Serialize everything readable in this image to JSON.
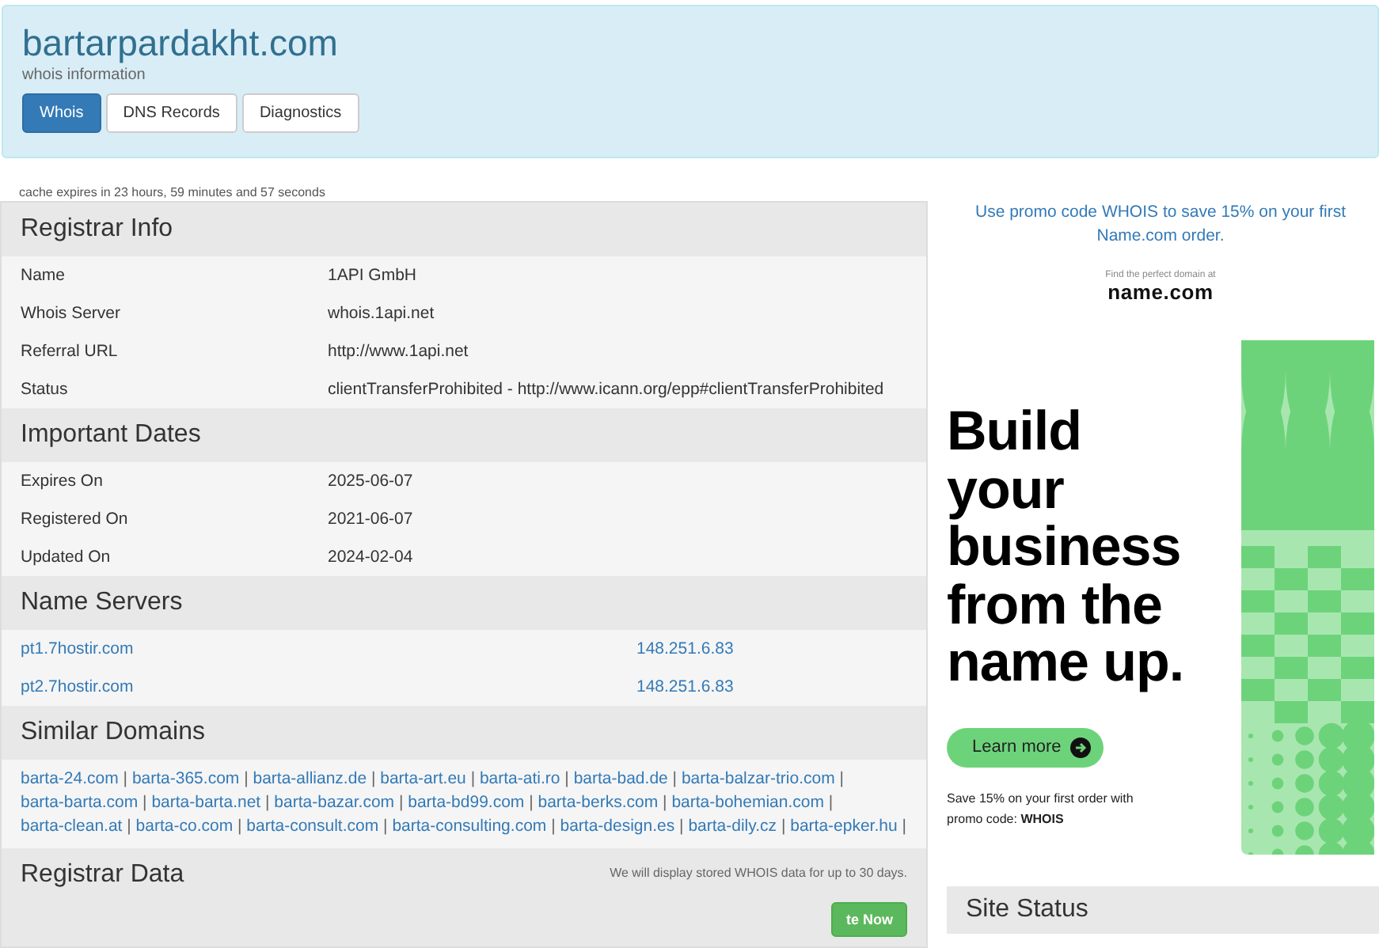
{
  "header": {
    "title": "bartarpardakht.com",
    "subtitle": "whois information",
    "tabs": [
      {
        "label": "Whois",
        "selected": true
      },
      {
        "label": "DNS Records",
        "selected": false
      },
      {
        "label": "Diagnostics",
        "selected": false
      }
    ]
  },
  "cache_note": "cache expires in 23 hours, 59 minutes and 57 seconds",
  "sections": [
    {
      "kind": "table",
      "title": "Registrar Info",
      "rows": [
        {
          "label": "Name",
          "value": "1API GmbH"
        },
        {
          "label": "Whois Server",
          "value": "whois.1api.net"
        },
        {
          "label": "Referral URL",
          "value": "http://www.1api.net"
        },
        {
          "label": "Status",
          "value": "clientTransferProhibited - http://www.icann.org/epp#clientTransferProhibited"
        }
      ]
    },
    {
      "kind": "table",
      "title": "Important Dates",
      "rows": [
        {
          "label": "Expires On",
          "value": "2025-06-07"
        },
        {
          "label": "Registered On",
          "value": "2021-06-07"
        },
        {
          "label": "Updated On",
          "value": "2024-02-04"
        }
      ]
    },
    {
      "kind": "servers",
      "title": "Name Servers",
      "rows": [
        {
          "label": "pt1.7hostir.com",
          "value": "148.251.6.83"
        },
        {
          "label": "pt2.7hostir.com",
          "value": "148.251.6.83"
        }
      ]
    },
    {
      "kind": "links",
      "title": "Similar Domains",
      "separator": "|",
      "links": [
        "barta-24.com",
        "barta-365.com",
        "barta-allianz.de",
        "barta-art.eu",
        "barta-ati.ro",
        "barta-bad.de",
        "barta-balzar-trio.com",
        "barta-barta.com",
        "barta-barta.net",
        "barta-bazar.com",
        "barta-bd99.com",
        "barta-berks.com",
        "barta-bohemian.com",
        "barta-clean.at",
        "barta-co.com",
        "barta-consult.com",
        "barta-consulting.com",
        "barta-design.es",
        "barta-dily.cz",
        "barta-epker.hu"
      ]
    },
    {
      "kind": "data",
      "title": "Registrar Data",
      "note": "We will display stored WHOIS data for up to 30 days.",
      "button": "te Now"
    }
  ],
  "sidebar": {
    "promo": "Use promo code WHOIS to save 15% on your first Name.com order.",
    "ad": {
      "tagline": "Find the perfect domain at",
      "logo": "name.com",
      "headline": [
        "Build",
        "your",
        "business",
        "from the",
        "name up."
      ],
      "button": "Learn more",
      "footnote": "Save 15% on your first order with promo code: **WHOIS**"
    },
    "status_title": "Site Status"
  }
}
